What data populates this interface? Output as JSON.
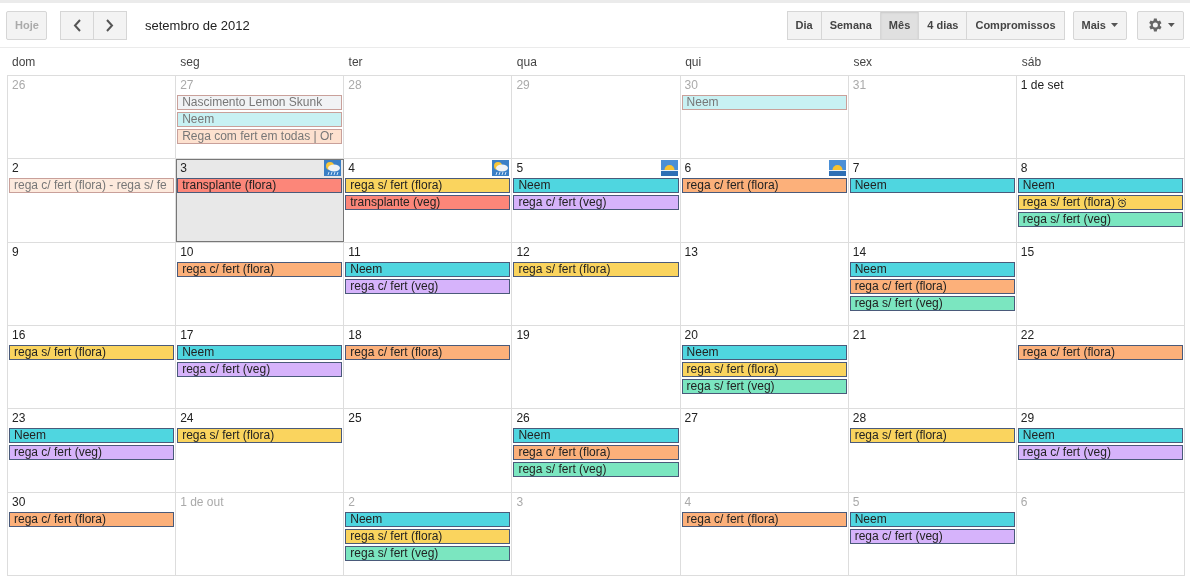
{
  "toolbar": {
    "today_button": {
      "label": "Hoje",
      "disabled": true
    },
    "title": "setembro de 2012",
    "views": [
      {
        "label": "Dia",
        "selected": false
      },
      {
        "label": "Semana",
        "selected": false
      },
      {
        "label": "Mês",
        "selected": true
      },
      {
        "label": "4 dias",
        "selected": false
      },
      {
        "label": "Compromissos",
        "selected": false
      }
    ],
    "more_button": "Mais"
  },
  "weekdays": [
    "dom",
    "seg",
    "ter",
    "qua",
    "qui",
    "sex",
    "sáb"
  ],
  "weeks": [
    {
      "days": [
        {
          "label": "26",
          "other_month": true,
          "today": false
        },
        {
          "label": "27",
          "other_month": true,
          "today": false,
          "events": [
            {
              "title": "Nascimento Lemon Skunk",
              "color": "#f1f3f5",
              "faded": true
            },
            {
              "title": "Neem",
              "color": "#c8f1f3",
              "faded": true
            },
            {
              "title": "Rega com fert em todas | Or",
              "color": "#fde1cf",
              "faded": true
            }
          ]
        },
        {
          "label": "28",
          "other_month": true,
          "today": false
        },
        {
          "label": "29",
          "other_month": true,
          "today": false
        },
        {
          "label": "30",
          "other_month": true,
          "today": false,
          "events": [
            {
              "title": "Neem",
              "color": "#c8f1f3",
              "faded": true
            }
          ]
        },
        {
          "label": "31",
          "other_month": true,
          "today": false
        },
        {
          "label": "1 de set",
          "other_month": false,
          "today": false
        }
      ]
    },
    {
      "days": [
        {
          "label": "2",
          "other_month": false,
          "today": false,
          "events": [
            {
              "title": "rega c/ fert (flora) - rega s/ fe",
              "color": "#fdeadd",
              "faded": true
            }
          ]
        },
        {
          "label": "3",
          "other_month": false,
          "today": true,
          "weather": {
            "kind": "rain"
          },
          "events": [
            {
              "title": "transplante (flora)",
              "color": "#fc8679",
              "faded": false
            }
          ]
        },
        {
          "label": "4",
          "other_month": false,
          "today": false,
          "weather": {
            "kind": "rain"
          },
          "events": [
            {
              "title": "rega s/ fert (flora)",
              "color": "#fad45e",
              "faded": false
            },
            {
              "title": "transplante (veg)",
              "color": "#fc8679",
              "faded": false
            }
          ]
        },
        {
          "label": "5",
          "other_month": false,
          "today": false,
          "weather": {
            "kind": "sun"
          },
          "events": [
            {
              "title": "Neem",
              "color": "#4fd6e0",
              "faded": false
            },
            {
              "title": "rega c/ fert (veg)",
              "color": "#d6b3fb",
              "faded": false
            }
          ]
        },
        {
          "label": "6",
          "other_month": false,
          "today": false,
          "weather": {
            "kind": "sun"
          },
          "events": [
            {
              "title": "rega c/ fert (flora)",
              "color": "#fcb07a",
              "faded": false
            }
          ]
        },
        {
          "label": "7",
          "other_month": false,
          "today": false,
          "events": [
            {
              "title": "Neem",
              "color": "#4fd6e0",
              "faded": false
            }
          ]
        },
        {
          "label": "8",
          "other_month": false,
          "today": false,
          "events": [
            {
              "title": "Neem",
              "color": "#4fd6e0",
              "faded": false
            },
            {
              "title": "rega s/ fert (flora)",
              "color": "#fad45e",
              "faded": false,
              "alarm": true
            },
            {
              "title": "rega s/ fert (veg)",
              "color": "#7be6c0",
              "faded": false
            }
          ]
        }
      ]
    },
    {
      "days": [
        {
          "label": "9",
          "other_month": false,
          "today": false
        },
        {
          "label": "10",
          "other_month": false,
          "today": false,
          "events": [
            {
              "title": "rega c/ fert (flora)",
              "color": "#fcb07a",
              "faded": false
            }
          ]
        },
        {
          "label": "11",
          "other_month": false,
          "today": false,
          "events": [
            {
              "title": "Neem",
              "color": "#4fd6e0",
              "faded": false
            },
            {
              "title": "rega c/ fert (veg)",
              "color": "#d6b3fb",
              "faded": false
            }
          ]
        },
        {
          "label": "12",
          "other_month": false,
          "today": false,
          "events": [
            {
              "title": "rega s/ fert (flora)",
              "color": "#fad45e",
              "faded": false
            }
          ]
        },
        {
          "label": "13",
          "other_month": false,
          "today": false
        },
        {
          "label": "14",
          "other_month": false,
          "today": false,
          "events": [
            {
              "title": "Neem",
              "color": "#4fd6e0",
              "faded": false
            },
            {
              "title": "rega c/ fert (flora)",
              "color": "#fcb07a",
              "faded": false
            },
            {
              "title": "rega s/ fert (veg)",
              "color": "#7be6c0",
              "faded": false
            }
          ]
        },
        {
          "label": "15",
          "other_month": false,
          "today": false
        }
      ]
    },
    {
      "days": [
        {
          "label": "16",
          "other_month": false,
          "today": false,
          "events": [
            {
              "title": "rega s/ fert (flora)",
              "color": "#fad45e",
              "faded": false
            }
          ]
        },
        {
          "label": "17",
          "other_month": false,
          "today": false,
          "events": [
            {
              "title": "Neem",
              "color": "#4fd6e0",
              "faded": false
            },
            {
              "title": "rega c/ fert (veg)",
              "color": "#d6b3fb",
              "faded": false
            }
          ]
        },
        {
          "label": "18",
          "other_month": false,
          "today": false,
          "events": [
            {
              "title": "rega c/ fert (flora)",
              "color": "#fcb07a",
              "faded": false
            }
          ]
        },
        {
          "label": "19",
          "other_month": false,
          "today": false
        },
        {
          "label": "20",
          "other_month": false,
          "today": false,
          "events": [
            {
              "title": "Neem",
              "color": "#4fd6e0",
              "faded": false
            },
            {
              "title": "rega s/ fert (flora)",
              "color": "#fad45e",
              "faded": false
            },
            {
              "title": "rega s/ fert (veg)",
              "color": "#7be6c0",
              "faded": false
            }
          ]
        },
        {
          "label": "21",
          "other_month": false,
          "today": false
        },
        {
          "label": "22",
          "other_month": false,
          "today": false,
          "events": [
            {
              "title": "rega c/ fert (flora)",
              "color": "#fcb07a",
              "faded": false
            }
          ]
        }
      ]
    },
    {
      "days": [
        {
          "label": "23",
          "other_month": false,
          "today": false,
          "events": [
            {
              "title": "Neem",
              "color": "#4fd6e0",
              "faded": false
            },
            {
              "title": "rega c/ fert (veg)",
              "color": "#d6b3fb",
              "faded": false
            }
          ]
        },
        {
          "label": "24",
          "other_month": false,
          "today": false,
          "events": [
            {
              "title": "rega s/ fert (flora)",
              "color": "#fad45e",
              "faded": false
            }
          ]
        },
        {
          "label": "25",
          "other_month": false,
          "today": false
        },
        {
          "label": "26",
          "other_month": false,
          "today": false,
          "events": [
            {
              "title": "Neem",
              "color": "#4fd6e0",
              "faded": false
            },
            {
              "title": "rega c/ fert (flora)",
              "color": "#fcb07a",
              "faded": false
            },
            {
              "title": "rega s/ fert (veg)",
              "color": "#7be6c0",
              "faded": false
            }
          ]
        },
        {
          "label": "27",
          "other_month": false,
          "today": false
        },
        {
          "label": "28",
          "other_month": false,
          "today": false,
          "events": [
            {
              "title": "rega s/ fert (flora)",
              "color": "#fad45e",
              "faded": false
            }
          ]
        },
        {
          "label": "29",
          "other_month": false,
          "today": false,
          "events": [
            {
              "title": "Neem",
              "color": "#4fd6e0",
              "faded": false
            },
            {
              "title": "rega c/ fert (veg)",
              "color": "#d6b3fb",
              "faded": false
            }
          ]
        }
      ]
    },
    {
      "days": [
        {
          "label": "30",
          "other_month": false,
          "today": false,
          "events": [
            {
              "title": "rega c/ fert (flora)",
              "color": "#fcb07a",
              "faded": false
            }
          ]
        },
        {
          "label": "1 de out",
          "other_month": true,
          "today": false
        },
        {
          "label": "2",
          "other_month": true,
          "today": false,
          "events": [
            {
              "title": "Neem",
              "color": "#4fd6e0",
              "faded": false
            },
            {
              "title": "rega s/ fert (flora)",
              "color": "#fad45e",
              "faded": false
            },
            {
              "title": "rega s/ fert (veg)",
              "color": "#7be6c0",
              "faded": false
            }
          ]
        },
        {
          "label": "3",
          "other_month": true,
          "today": false
        },
        {
          "label": "4",
          "other_month": true,
          "today": false,
          "events": [
            {
              "title": "rega c/ fert (flora)",
              "color": "#fcb07a",
              "faded": false
            }
          ]
        },
        {
          "label": "5",
          "other_month": true,
          "today": false,
          "events": [
            {
              "title": "Neem",
              "color": "#4fd6e0",
              "faded": false
            },
            {
              "title": "rega c/ fert (veg)",
              "color": "#d6b3fb",
              "faded": false
            }
          ]
        },
        {
          "label": "6",
          "other_month": true,
          "today": false
        }
      ]
    }
  ]
}
